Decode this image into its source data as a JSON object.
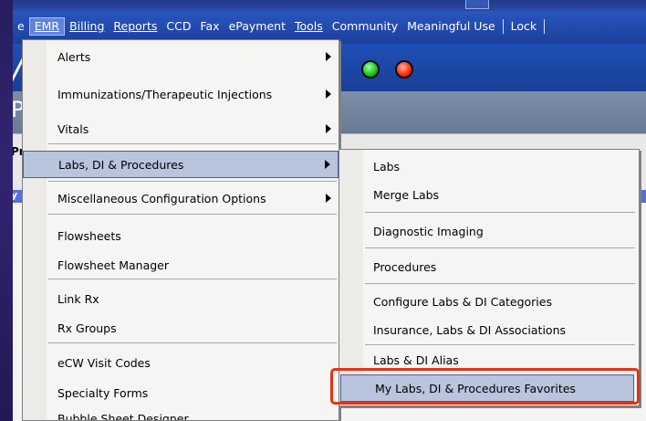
{
  "menubar": {
    "items": [
      {
        "label": "e",
        "active": false
      },
      {
        "label": "EMR",
        "active": true
      },
      {
        "label": "Billing",
        "active": false
      },
      {
        "label": "Reports",
        "active": false
      },
      {
        "label": "CCD",
        "active": false
      },
      {
        "label": "Fax",
        "active": false
      },
      {
        "label": "ePayment",
        "active": false
      },
      {
        "label": "Tools",
        "active": false
      },
      {
        "label": "Community",
        "active": false
      },
      {
        "label": "Meaningful Use",
        "active": false
      },
      {
        "label": "Lock",
        "active": false
      }
    ]
  },
  "background": {
    "band2_text": "Pr",
    "band3_text": "Pr",
    "bluestrip_text": "y"
  },
  "emr_menu": {
    "items": [
      {
        "label": "Alerts",
        "submenu": true
      },
      {
        "label": "Immunizations/Therapeutic Injections",
        "submenu": true
      },
      {
        "label": "Vitals",
        "submenu": true
      },
      {
        "label": "Labs, DI & Procedures",
        "submenu": true,
        "highlighted": true
      },
      {
        "label": "Miscellaneous Configuration Options",
        "submenu": true
      },
      {
        "label": "Flowsheets",
        "submenu": false
      },
      {
        "label": "Flowsheet Manager",
        "submenu": false
      },
      {
        "label": "Link Rx",
        "submenu": false
      },
      {
        "label": "Rx Groups",
        "submenu": false
      },
      {
        "label": "eCW Visit Codes",
        "submenu": false
      },
      {
        "label": "Specialty Forms",
        "submenu": false
      },
      {
        "label": "Bubble Sheet Designer",
        "submenu": false
      }
    ]
  },
  "labs_submenu": {
    "items": [
      {
        "label": "Labs"
      },
      {
        "label": "Merge Labs"
      },
      {
        "label": "Diagnostic Imaging"
      },
      {
        "label": "Procedures"
      },
      {
        "label": "Configure Labs & DI Categories"
      },
      {
        "label": "Insurance, Labs & DI Associations"
      },
      {
        "label": "Labs & DI Alias"
      },
      {
        "label": "My Labs, DI & Procedures Favorites",
        "highlighted": true
      }
    ]
  },
  "colors": {
    "highlight": "#b9c4dd",
    "menubar": "#2a56c0",
    "callout": "#e03414",
    "status_green": "#17c21b",
    "status_red": "#ff2a00"
  }
}
